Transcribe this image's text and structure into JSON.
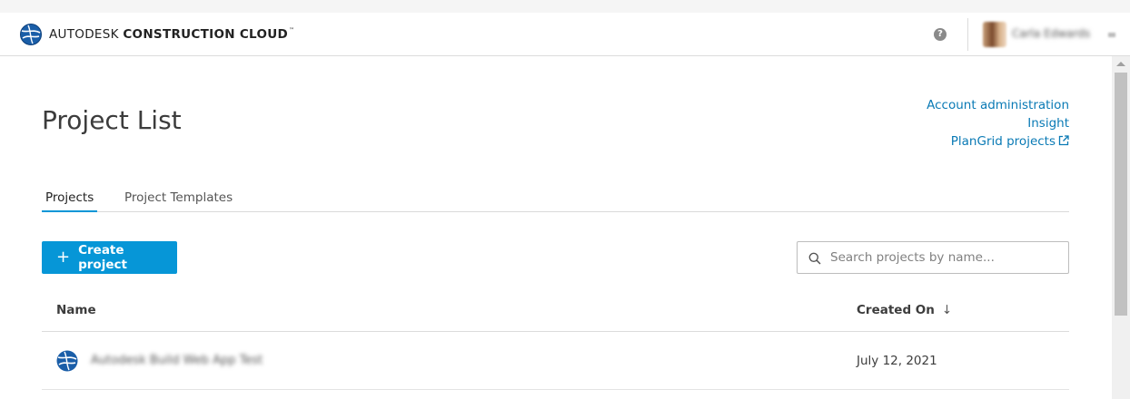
{
  "header": {
    "brand_light": "AUTODESK",
    "brand_bold": "CONSTRUCTION CLOUD",
    "brand_tm": "™",
    "help_glyph": "?",
    "user_name": "Carla Edwards"
  },
  "page": {
    "title": "Project List"
  },
  "links": {
    "account_admin": "Account administration",
    "insight": "Insight",
    "plangrid": "PlanGrid projects"
  },
  "tabs": [
    {
      "label": "Projects",
      "active": true
    },
    {
      "label": "Project Templates",
      "active": false
    }
  ],
  "toolbar": {
    "create_label": "Create project",
    "create_glyph": "+",
    "search_placeholder": "Search projects by name..."
  },
  "table": {
    "columns": {
      "name": "Name",
      "created": "Created On"
    },
    "sort_glyph": "↓",
    "rows": [
      {
        "name": "Autodesk Build Web App Test",
        "created": "July 12, 2021"
      }
    ]
  },
  "colors": {
    "accent": "#0696d7",
    "link": "#0a7ab5"
  }
}
